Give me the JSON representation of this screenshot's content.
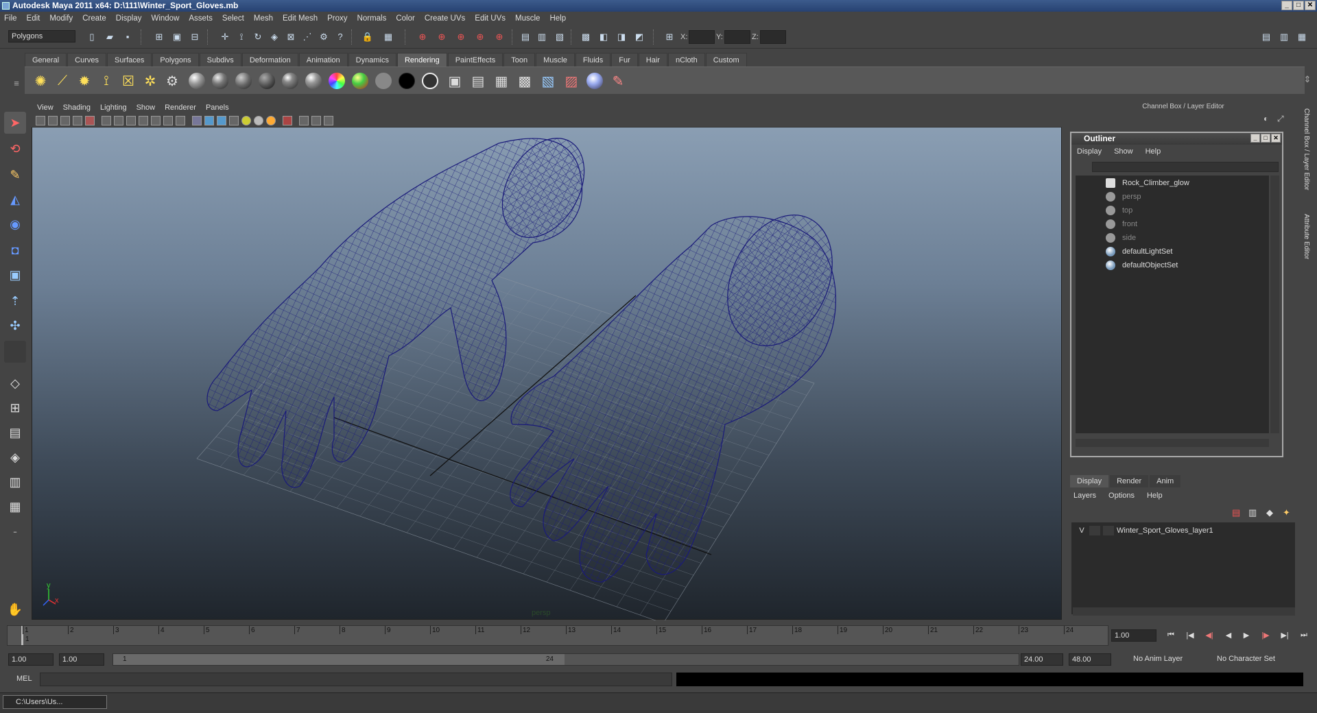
{
  "window": {
    "title": "Autodesk Maya 2011 x64: D:\\111\\Winter_Sport_Gloves.mb"
  },
  "menubar": [
    "File",
    "Edit",
    "Modify",
    "Create",
    "Display",
    "Window",
    "Assets",
    "Select",
    "Mesh",
    "Edit Mesh",
    "Proxy",
    "Normals",
    "Color",
    "Create UVs",
    "Edit UVs",
    "Muscle",
    "Help"
  ],
  "statusline": {
    "mode": "Polygons",
    "x_label": "X:",
    "y_label": "Y:",
    "z_label": "Z:"
  },
  "shelf": {
    "tabs": [
      "General",
      "Curves",
      "Surfaces",
      "Polygons",
      "Subdivs",
      "Deformation",
      "Animation",
      "Dynamics",
      "Rendering",
      "PaintEffects",
      "Toon",
      "Muscle",
      "Fluids",
      "Fur",
      "Hair",
      "nCloth",
      "Custom"
    ],
    "active_tab": "Rendering"
  },
  "viewport": {
    "menu": [
      "View",
      "Shading",
      "Lighting",
      "Show",
      "Renderer",
      "Panels"
    ],
    "camera_label": "persp",
    "axis_y": "y",
    "axis_x": "x",
    "wire_color": "#1a1a7a"
  },
  "right_panel": {
    "header": "Channel Box / Layer Editor",
    "side_tab_1": "Channel Box / Layer Editor",
    "side_tab_2": "Attribute Editor"
  },
  "outliner": {
    "title": "Outliner",
    "menu": [
      "Display",
      "Show",
      "Help"
    ],
    "items": [
      {
        "label": "Rock_Climber_glow",
        "dimmed": false
      },
      {
        "label": "persp",
        "dimmed": true
      },
      {
        "label": "top",
        "dimmed": true
      },
      {
        "label": "front",
        "dimmed": true
      },
      {
        "label": "side",
        "dimmed": true
      },
      {
        "label": "defaultLightSet",
        "dimmed": false
      },
      {
        "label": "defaultObjectSet",
        "dimmed": false
      }
    ]
  },
  "layer_editor": {
    "tabs": [
      "Display",
      "Render",
      "Anim"
    ],
    "active_tab": "Display",
    "menu": [
      "Layers",
      "Options",
      "Help"
    ],
    "layer": {
      "visible": "V",
      "name": "Winter_Sport_Gloves_layer1"
    }
  },
  "timeline": {
    "ticks": [
      "1",
      "2",
      "3",
      "4",
      "5",
      "6",
      "7",
      "8",
      "9",
      "10",
      "11",
      "12",
      "13",
      "14",
      "15",
      "16",
      "17",
      "18",
      "19",
      "20",
      "21",
      "22",
      "23",
      "24"
    ],
    "current_frame": "1.00",
    "current_marker": "1"
  },
  "range": {
    "start": "1.00",
    "playback_start": "1.00",
    "slider_start": "1",
    "slider_end": "24",
    "playback_end": "24.00",
    "end": "48.00",
    "anim_layer": "No Anim Layer",
    "character_set": "No Character Set"
  },
  "command": {
    "label": "MEL"
  },
  "taskbar": {
    "item": "C:\\Users\\Us..."
  }
}
